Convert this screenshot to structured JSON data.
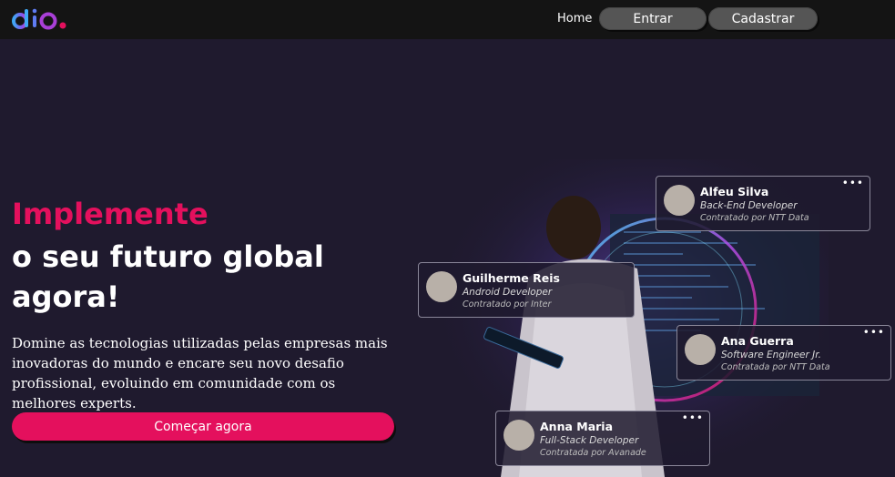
{
  "nav": {
    "home_label": "Home",
    "login_label": "Entrar",
    "signup_label": "Cadastrar"
  },
  "hero": {
    "headline_accent": "Implemente",
    "headline_rest": "o seu futuro global agora!",
    "description": "Domine as tecnologias utilizadas pelas empresas mais inovadoras do mundo e encare seu novo desafio profissional, evoluindo em comunidade com os melhores experts.",
    "cta_label": "Começar agora"
  },
  "cards": [
    {
      "name": "Alfeu Silva",
      "role": "Back-End Developer",
      "company": "Contratado por NTT Data"
    },
    {
      "name": "Guilherme Reis",
      "role": "Android Developer",
      "company": "Contratado por Inter"
    },
    {
      "name": "Ana Guerra",
      "role": "Software Engineer Jr.",
      "company": "Contratada por NTT Data"
    },
    {
      "name": "Anna Maria",
      "role": "Full-Stack Developer",
      "company": "Contratada por Avanade"
    }
  ],
  "menu_glyph": "•••",
  "colors": {
    "accent": "#e4105d",
    "background": "#1f1a2e",
    "topbar": "#141414",
    "nav_button": "#555555"
  }
}
